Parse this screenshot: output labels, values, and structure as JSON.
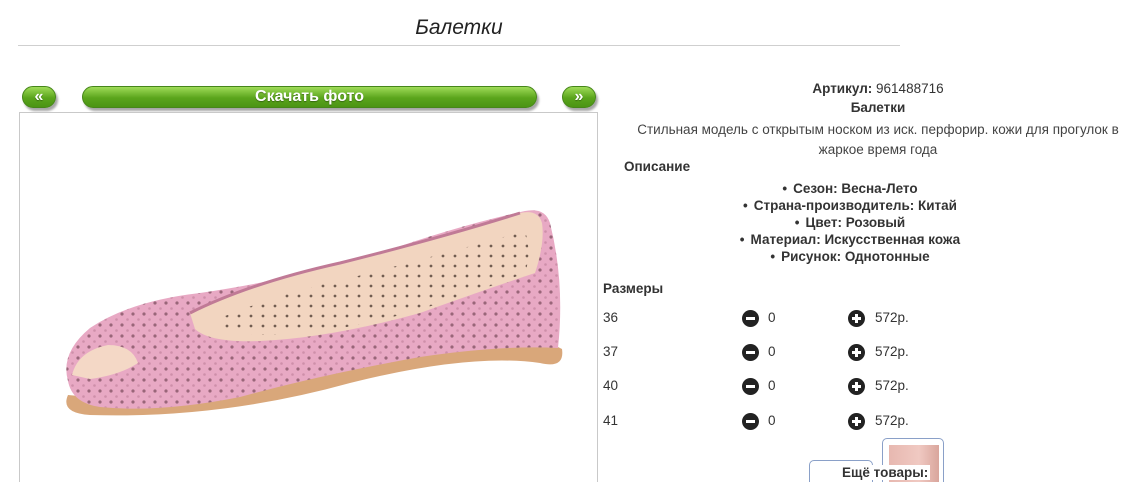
{
  "title": "Балетки",
  "nav": {
    "prev_label": "«",
    "download_label": "Скачать фото",
    "next_label": "»"
  },
  "product": {
    "article_label": "Артикул:",
    "article_value": "961488716",
    "name": "Балетки",
    "description": "Стильная модель с открытым носком из иск. перфорир. кожи для прогулок в жаркое время года",
    "description_title": "Описание",
    "properties": [
      "Сезон: Весна-Лето",
      "Страна-производитель: Китай",
      "Цвет: Розовый",
      "Материал: Искусственная кожа",
      "Рисунок: Однотонные"
    ]
  },
  "sizes": {
    "title": "Размеры",
    "rows": [
      {
        "size": "36",
        "qty": "0",
        "price": "572р."
      },
      {
        "size": "37",
        "qty": "0",
        "price": "572р."
      },
      {
        "size": "40",
        "qty": "0",
        "price": "572р."
      },
      {
        "size": "41",
        "qty": "0",
        "price": "572р."
      }
    ]
  },
  "more_label": "Ещё товары:",
  "icons": {
    "minus": "minus-circle-icon",
    "plus": "plus-circle-icon"
  },
  "colors": {
    "button_green": "#5aa51c",
    "shoe_pink": "#e8a9c4"
  }
}
